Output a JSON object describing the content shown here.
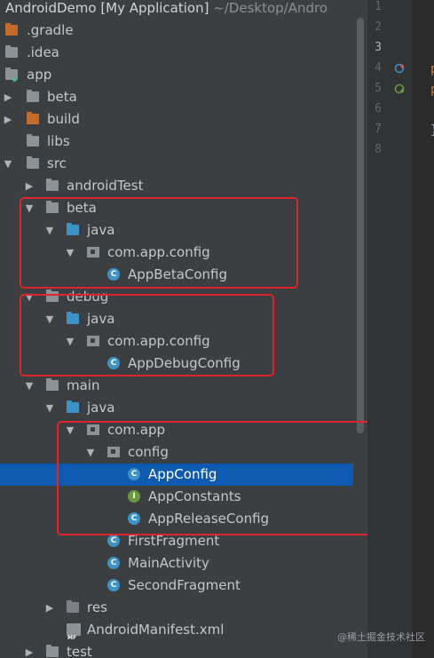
{
  "window": {
    "project_name": "AndroidDemo [My Application]",
    "project_path": "~/Desktop/Andro"
  },
  "tree": [
    {
      "label": "AndroidDemo [My Application]",
      "level": 0
    },
    {
      "label": ".gradle",
      "level": 0,
      "icon": "folder-orange"
    },
    {
      "label": ".idea",
      "level": 0,
      "icon": "folder-grey"
    },
    {
      "label": "app",
      "level": 0,
      "icon": "module-folder",
      "expanded": true
    },
    {
      "label": "beta",
      "level": 1,
      "icon": "folder-grey",
      "expanded": false
    },
    {
      "label": "build",
      "level": 1,
      "icon": "folder-orange",
      "expanded": false
    },
    {
      "label": "libs",
      "level": 1,
      "icon": "folder-grey"
    },
    {
      "label": "src",
      "level": 1,
      "icon": "folder-grey",
      "expanded": true
    },
    {
      "label": "androidTest",
      "level": 2,
      "icon": "folder-grey",
      "expanded": false
    },
    {
      "label": "beta",
      "level": 2,
      "icon": "folder-grey",
      "expanded": true
    },
    {
      "label": "java",
      "level": 3,
      "icon": "folder-blue",
      "expanded": true
    },
    {
      "label": "com.app.config",
      "level": 4,
      "icon": "package",
      "expanded": true
    },
    {
      "label": "AppBetaConfig",
      "level": 5,
      "icon": "class"
    },
    {
      "label": "debug",
      "level": 2,
      "icon": "folder-grey",
      "expanded": true
    },
    {
      "label": "java",
      "level": 3,
      "icon": "folder-blue",
      "expanded": true
    },
    {
      "label": "com.app.config",
      "level": 4,
      "icon": "package",
      "expanded": true
    },
    {
      "label": "AppDebugConfig",
      "level": 5,
      "icon": "class"
    },
    {
      "label": "main",
      "level": 2,
      "icon": "folder-grey",
      "expanded": true
    },
    {
      "label": "java",
      "level": 3,
      "icon": "folder-blue",
      "expanded": true
    },
    {
      "label": "com.app",
      "level": 4,
      "icon": "package",
      "expanded": true
    },
    {
      "label": "config",
      "level": 5,
      "icon": "package",
      "expanded": true
    },
    {
      "label": "AppConfig",
      "level": 6,
      "icon": "class",
      "selected": true
    },
    {
      "label": "AppConstants",
      "level": 6,
      "icon": "interface"
    },
    {
      "label": "AppReleaseConfig",
      "level": 6,
      "icon": "class"
    },
    {
      "label": "FirstFragment",
      "level": 5,
      "icon": "class"
    },
    {
      "label": "MainActivity",
      "level": 5,
      "icon": "class"
    },
    {
      "label": "SecondFragment",
      "level": 5,
      "icon": "class"
    },
    {
      "label": "res",
      "level": 3,
      "icon": "folder-dark",
      "expanded": false
    },
    {
      "label": "AndroidManifest.xml",
      "level": 3,
      "icon": "manifest"
    },
    {
      "label": "test",
      "level": 2,
      "icon": "folder-grey",
      "expanded": false
    }
  ],
  "gutter": {
    "line_numbers": [
      "1",
      "2",
      "3",
      "4",
      "5",
      "6",
      "7",
      "8"
    ],
    "current_line": "3"
  },
  "editor": {
    "line4_fragment": "p",
    "line5_fragment": "p",
    "line7_fragment": "}"
  },
  "watermark": "@稀土掘金技术社区",
  "colors": {
    "selection": "#0d5ab0",
    "highlight_box": "#e0242b",
    "class_icon": "#3d92c6",
    "interface_icon": "#68993e"
  }
}
